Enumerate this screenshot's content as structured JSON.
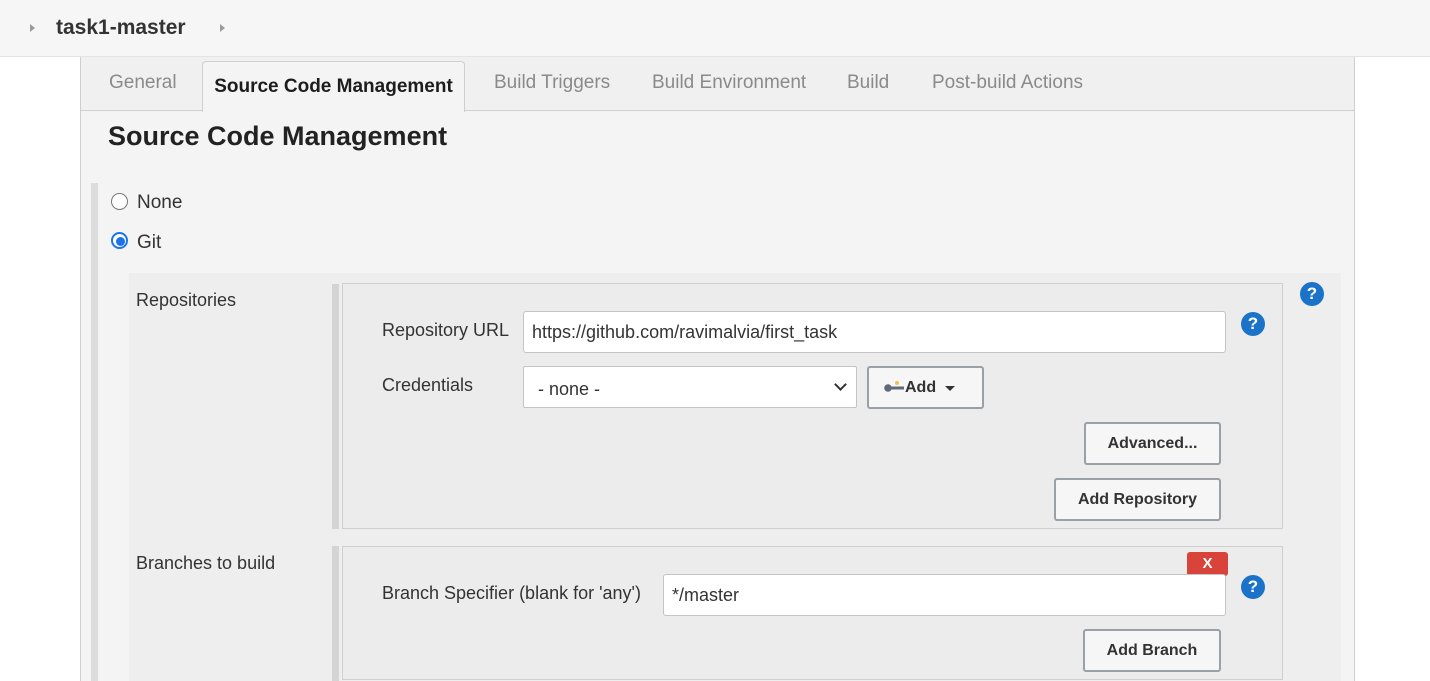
{
  "breadcrumb": {
    "job_name": "task1-master"
  },
  "tabs": {
    "general": "General",
    "scm": "Source Code Management",
    "build_triggers": "Build Triggers",
    "build_environment": "Build Environment",
    "build": "Build",
    "post_build": "Post-build Actions",
    "active": "Source Code Management"
  },
  "section": {
    "title": "Source Code Management"
  },
  "scm_options": [
    {
      "label": "None",
      "selected": false
    },
    {
      "label": "Git",
      "selected": true
    }
  ],
  "repositories": {
    "label": "Repositories",
    "url_label": "Repository URL",
    "url_value": "https://github.com/ravimalvia/first_task",
    "credentials_label": "Credentials",
    "credentials_value": "- none -",
    "add_label": "Add",
    "advanced_label": "Advanced...",
    "add_repository_label": "Add Repository"
  },
  "branches": {
    "label": "Branches to build",
    "specifier_label": "Branch Specifier (blank for 'any')",
    "specifier_value": "*/master",
    "delete_label": "X",
    "add_branch_label": "Add Branch"
  },
  "help_glyph": "?",
  "icons": {
    "breadcrumb_separator": "chevron-right-icon",
    "help": "question-icon",
    "key": "key-icon",
    "dropdown": "chevron-down-icon"
  },
  "colors": {
    "help_blue": "#1a73c8",
    "delete_red": "#d9443a",
    "radio_blue": "#1a73e8"
  }
}
